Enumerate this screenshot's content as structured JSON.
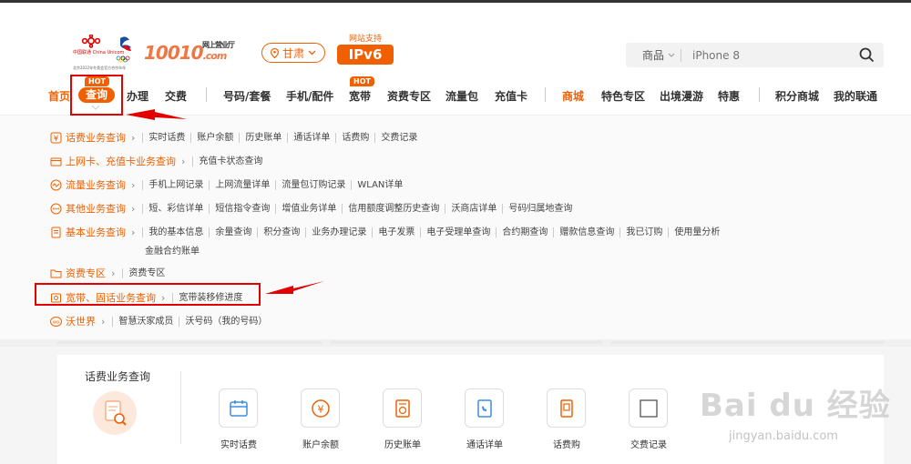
{
  "brand": {
    "unicom_cn": "中国联通",
    "unicom_en": "China Unicom",
    "hotline": "10010",
    "hall": "网上营业厅",
    "domain": ".com",
    "tagline": "北京2022年冬奥会官方合作伙伴"
  },
  "province": {
    "label": "甘肃"
  },
  "ipv6": {
    "caption": "网站支持",
    "label": "IPv6"
  },
  "search": {
    "category": "商品",
    "placeholder": "iPhone 8"
  },
  "nav": {
    "items": [
      "首页",
      "查询",
      "办理",
      "交费",
      "号码/套餐",
      "手机/配件",
      "宽带",
      "资费专区",
      "流量包",
      "充值卡",
      "商城",
      "特色专区",
      "出境漫游",
      "特惠",
      "积分商城",
      "我的联通"
    ],
    "hot": "HOT"
  },
  "dropdown": {
    "rows": [
      {
        "title": "话费业务查询",
        "links": [
          "实时话费",
          "账户余额",
          "历史账单",
          "通话详单",
          "话费购",
          "交费记录"
        ]
      },
      {
        "title": "上网卡、充值卡业务查询",
        "links": [
          "充值卡状态查询"
        ]
      },
      {
        "title": "流量业务查询",
        "links": [
          "手机上网记录",
          "上网流量详单",
          "流量包订购记录",
          "WLAN详单"
        ]
      },
      {
        "title": "其他业务查询",
        "links": [
          "短、彩信详单",
          "短信指令查询",
          "增值业务详单",
          "信用额度调整历史查询",
          "沃商店详单",
          "号码归属地查询"
        ]
      },
      {
        "title": "基本业务查询",
        "links": [
          "我的基本信息",
          "余量查询",
          "积分查询",
          "业务办理记录",
          "电子发票",
          "电子受理单查询",
          "合约期查询",
          "赠款信息查询",
          "我已订购",
          "使用量分析"
        ],
        "links2": [
          "金融合约账单"
        ]
      },
      {
        "title": "资费专区",
        "links": [
          "资费专区"
        ]
      },
      {
        "title": "宽带、固话业务查询",
        "links": [
          "宽带装移修进度"
        ]
      },
      {
        "title": "沃世界",
        "links": [
          "智慧沃家成员",
          "沃号码（我的号码）"
        ]
      }
    ]
  },
  "panel": {
    "title": "话费业务查询",
    "tiles": [
      "实时话费",
      "账户余额",
      "历史账单",
      "通话详单",
      "话费购",
      "交费记录"
    ]
  },
  "watermark": {
    "main": "Bai du 经验",
    "sub": "jingyan.baidu.com"
  },
  "colors": {
    "accent": "#f06000",
    "highlight": "#e30000"
  }
}
